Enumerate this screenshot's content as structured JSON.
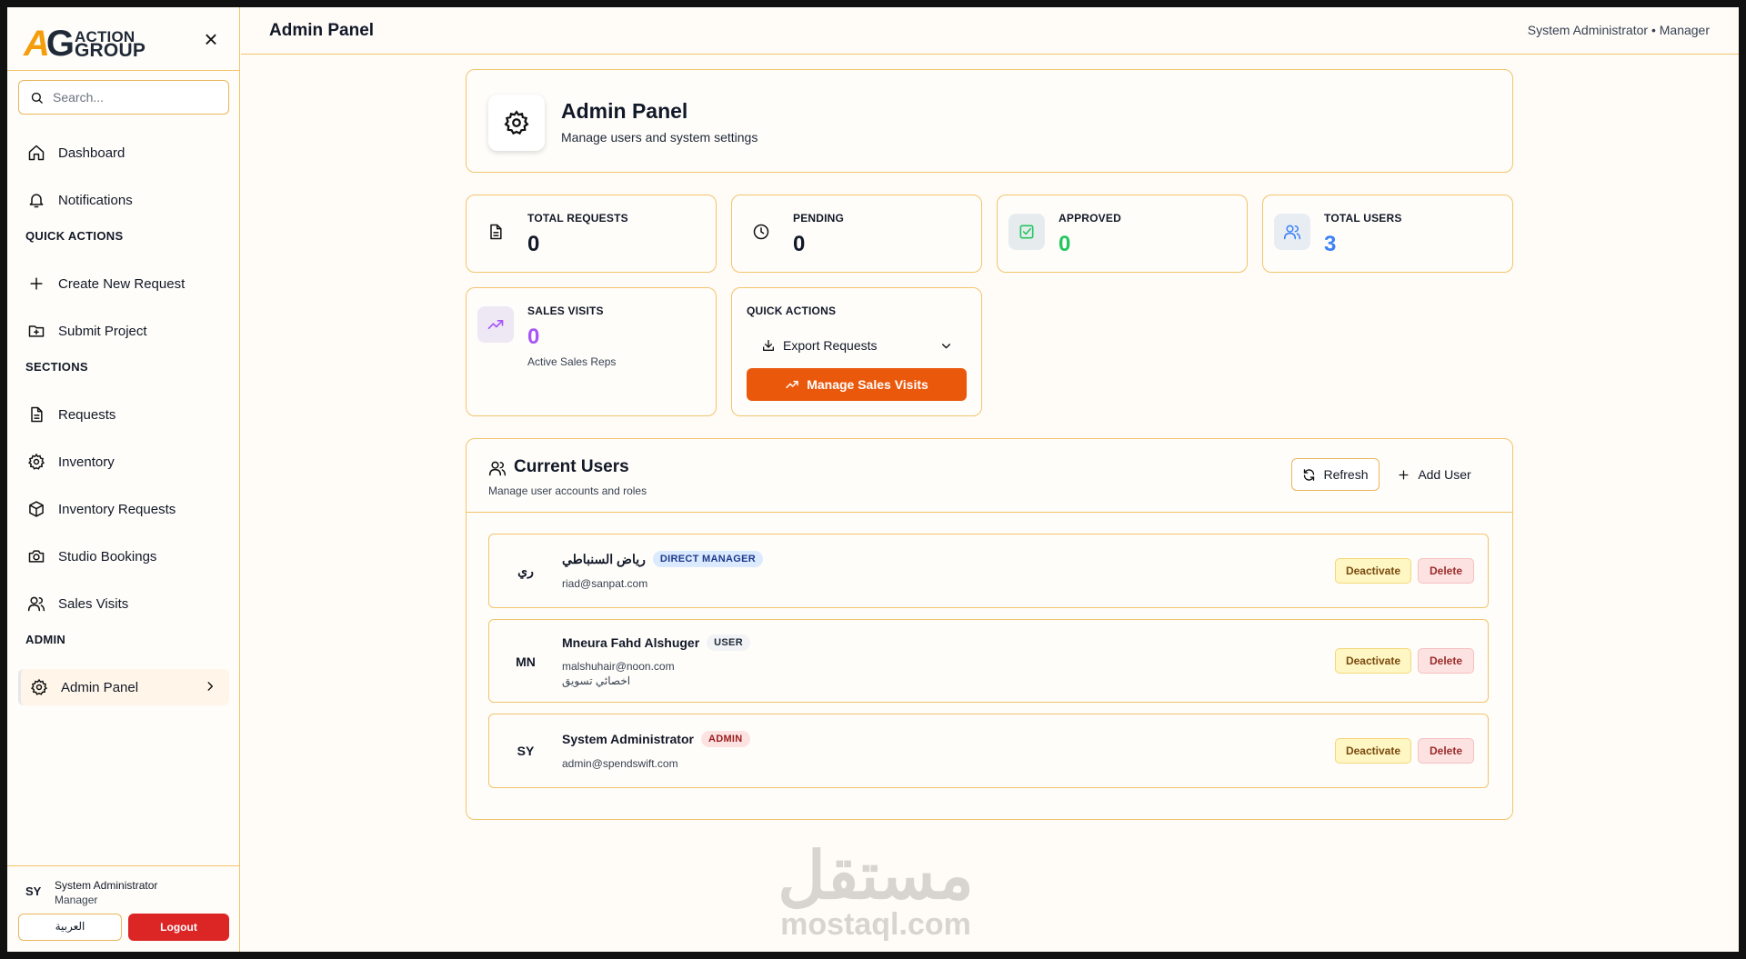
{
  "app": {
    "logo_mark": "AG",
    "logo_line1": "ACTION",
    "logo_line2": "GROUP"
  },
  "search": {
    "placeholder": "Search..."
  },
  "sidebar": {
    "top_items": [
      {
        "label": "Dashboard",
        "icon": "home-icon"
      },
      {
        "label": "Notifications",
        "icon": "bell-icon"
      }
    ],
    "quick_actions_title": "QUICK ACTIONS",
    "quick_actions": [
      {
        "label": "Create New Request",
        "icon": "plus-icon"
      },
      {
        "label": "Submit Project",
        "icon": "folder-plus-icon"
      }
    ],
    "sections_title": "SECTIONS",
    "sections": [
      {
        "label": "Requests",
        "icon": "file-icon"
      },
      {
        "label": "Inventory",
        "icon": "gear-icon"
      },
      {
        "label": "Inventory Requests",
        "icon": "package-icon"
      },
      {
        "label": "Studio Bookings",
        "icon": "camera-icon"
      },
      {
        "label": "Sales Visits",
        "icon": "users-icon"
      }
    ],
    "admin_title": "ADMIN",
    "admin_items": [
      {
        "label": "Admin Panel",
        "icon": "gear-icon"
      }
    ],
    "footer": {
      "avatar": "SY",
      "name": "System Administrator",
      "role": "Manager",
      "lang_button": "العربية",
      "logout_button": "Logout"
    }
  },
  "header": {
    "title": "Admin Panel",
    "user_info": "System Administrator • Manager"
  },
  "hero": {
    "title": "Admin Panel",
    "subtitle": "Manage users and system settings"
  },
  "stats": [
    {
      "label": "TOTAL REQUESTS",
      "value": "0",
      "color": "#111827"
    },
    {
      "label": "PENDING",
      "value": "0",
      "color": "#111827"
    },
    {
      "label": "APPROVED",
      "value": "0",
      "color": "#22c55e"
    },
    {
      "label": "TOTAL USERS",
      "value": "3",
      "color": "#3b82f6"
    }
  ],
  "sales_visits": {
    "label": "SALES VISITS",
    "value": "0",
    "note": "Active Sales Reps",
    "color": "#a855f7"
  },
  "quick_actions_card": {
    "title": "QUICK ACTIONS",
    "export_label": "Export Requests",
    "manage_label": "Manage Sales Visits"
  },
  "users_panel": {
    "title": "Current Users",
    "subtitle": "Manage user accounts and roles",
    "refresh_label": "Refresh",
    "add_label": "Add User",
    "deactivate_label": "Deactivate",
    "delete_label": "Delete",
    "users": [
      {
        "avatar": "ري",
        "name": "رياض السنباطي",
        "role": "DIRECT MANAGER",
        "email": "riad@sanpat.com",
        "title": ""
      },
      {
        "avatar": "MN",
        "name": "Mneura Fahd Alshuger",
        "role": "USER",
        "email": "malshuhair@noon.com",
        "title": "اخصائي تسويق"
      },
      {
        "avatar": "SY",
        "name": "System Administrator",
        "role": "ADMIN",
        "email": "admin@spendswift.com",
        "title": ""
      }
    ]
  },
  "watermark": {
    "arabic": "مستقل",
    "latin": "mostaql.com"
  }
}
